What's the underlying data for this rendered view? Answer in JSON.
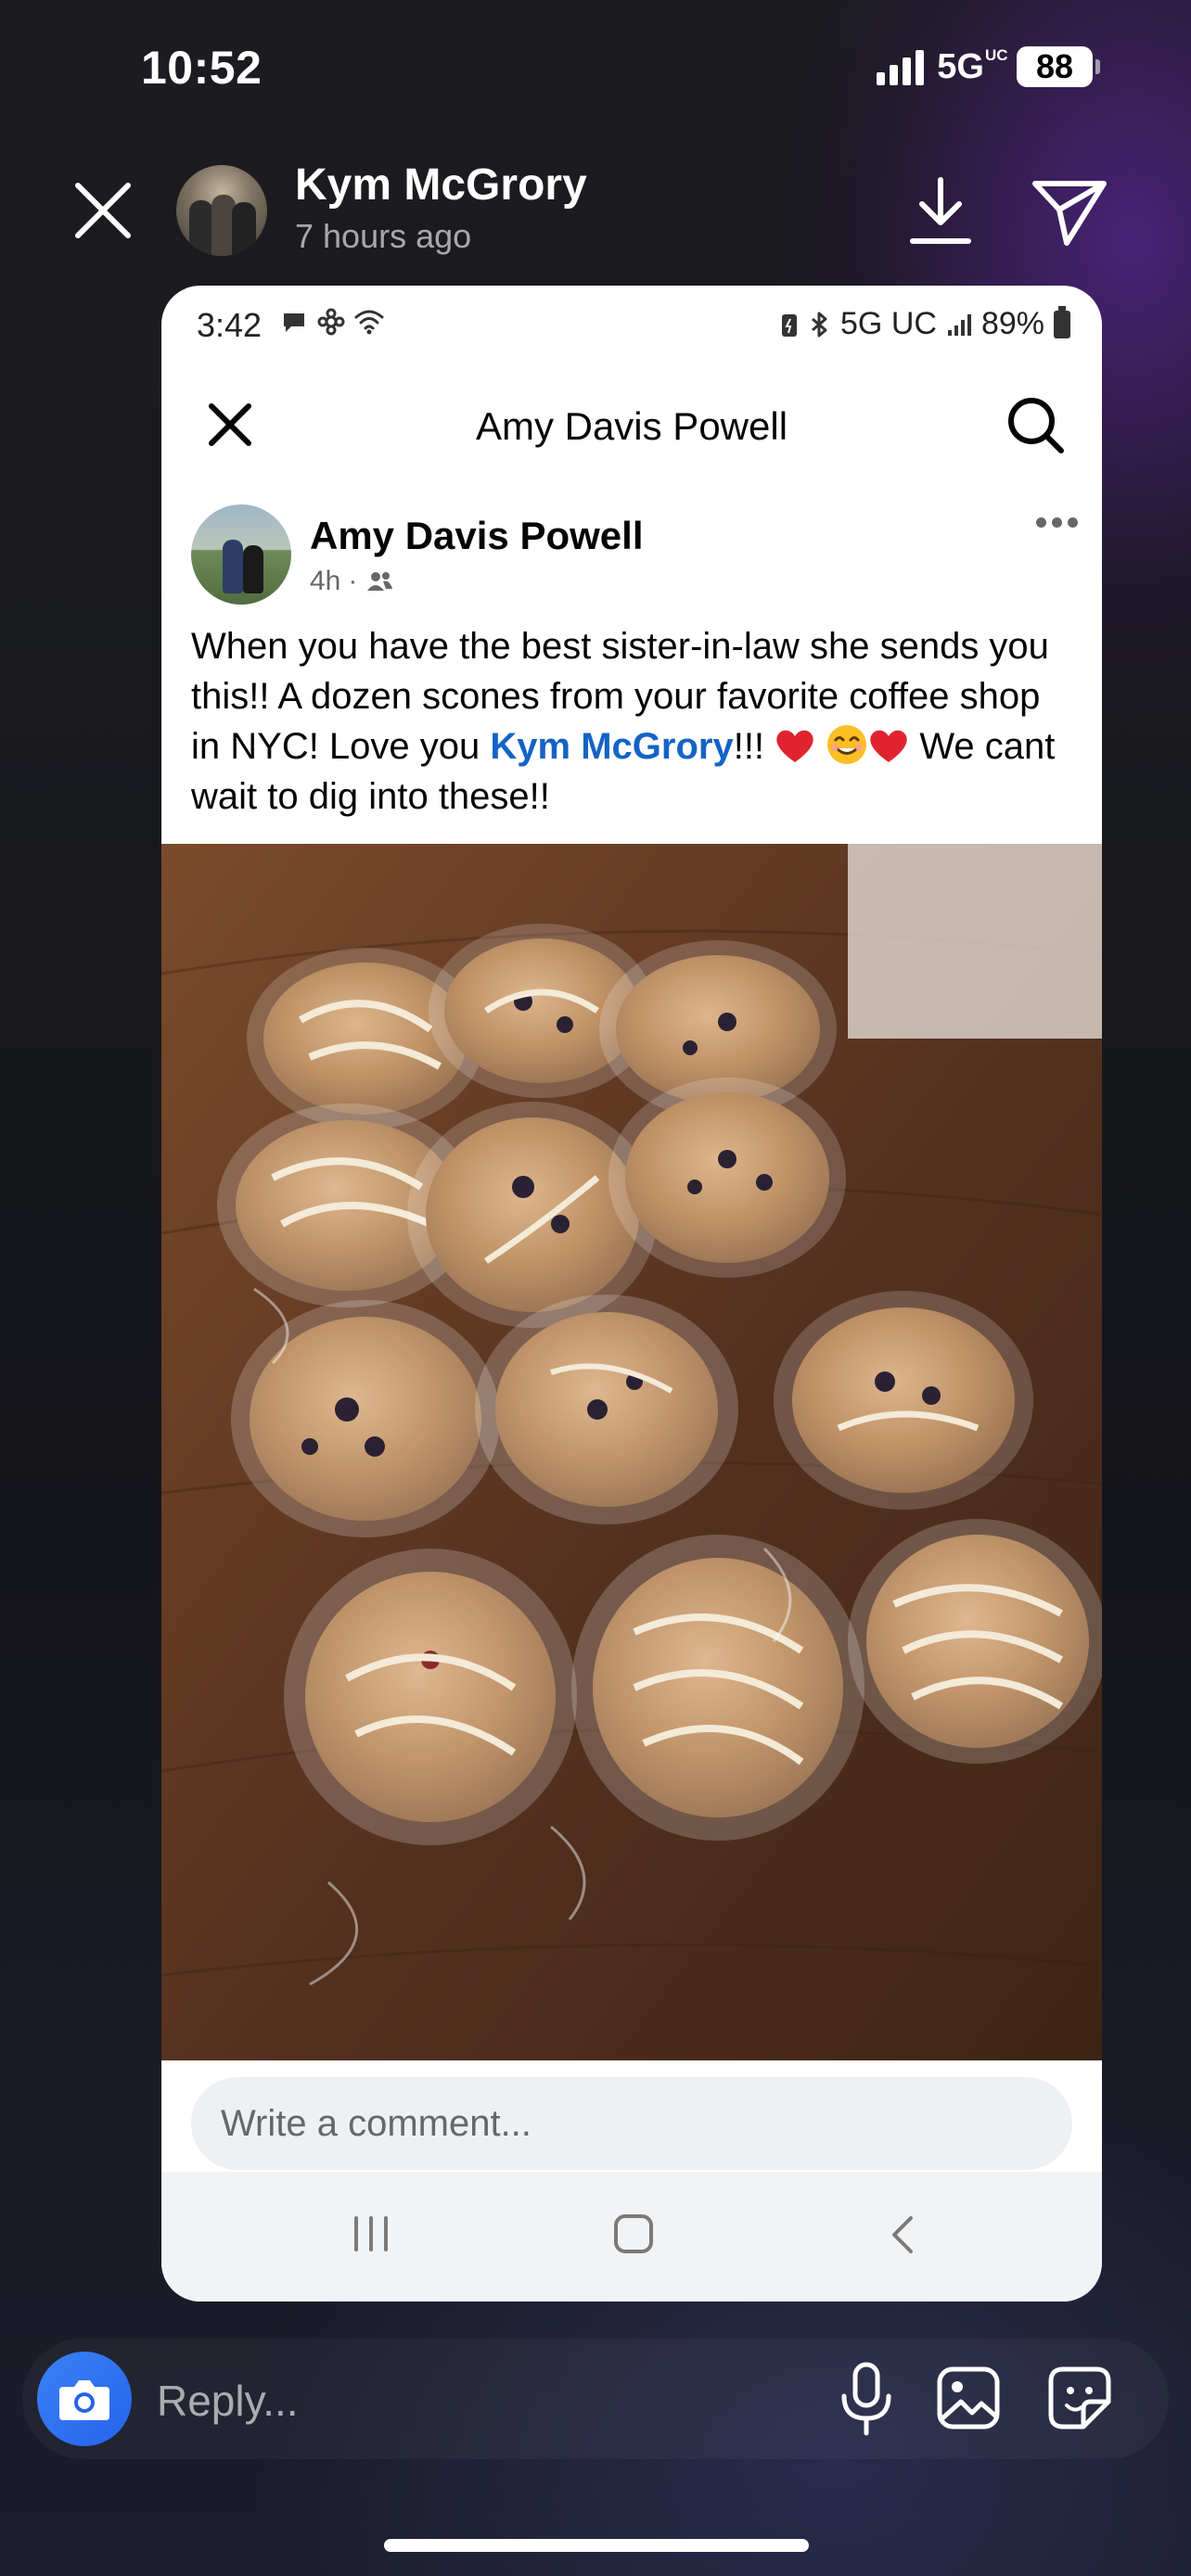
{
  "ios_status": {
    "time": "10:52",
    "network": "5G",
    "network_suffix": "UC",
    "battery": "88"
  },
  "story": {
    "user_name": "Kym McGrory",
    "posted_ago": "7 hours ago"
  },
  "shared_screenshot": {
    "status_bar": {
      "time": "3:42",
      "network": "5G UC",
      "battery": "89%"
    },
    "header_title": "Amy Davis Powell",
    "post": {
      "author": "Amy Davis Powell",
      "age": "4h",
      "separator": "·",
      "text_before": "When you have the best sister-in-law she sends you this!! A dozen scones from your favorite coffee shop in NYC! Love you ",
      "mention": "Kym McGrory",
      "text_after_mention": "!!! ",
      "text_end": " We cant wait to dig into these!!"
    },
    "comment_placeholder": "Write a comment..."
  },
  "reply": {
    "placeholder": "Reply..."
  },
  "colors": {
    "mention_blue": "#1463c6",
    "camera_blue": "#2563eb"
  }
}
